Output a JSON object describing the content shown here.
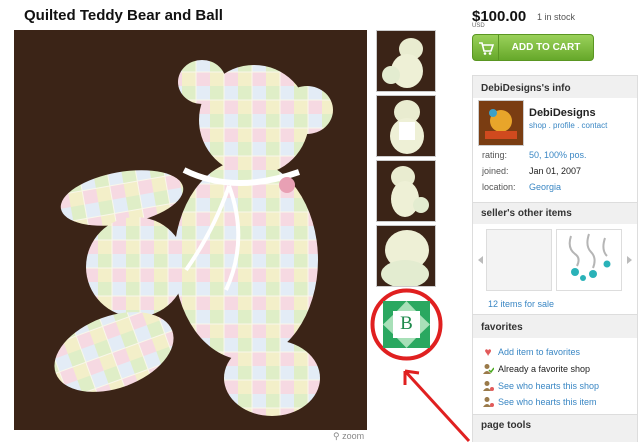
{
  "listing": {
    "title": "Quilted Teddy Bear and Ball",
    "price": "$100.00",
    "currency": "USD",
    "stock": "1 in stock",
    "add_to_cart": "ADD TO CART",
    "zoom": "zoom"
  },
  "shop_info": {
    "heading": "DebiDesigns's info",
    "name": "DebiDesigns",
    "links": [
      "shop",
      "profile",
      "contact"
    ],
    "rating_label": "rating:",
    "rating_value": "50, 100% pos.",
    "joined_label": "joined:",
    "joined_value": "Jan 01, 2007",
    "location_label": "location:",
    "location_value": "Georgia"
  },
  "other_items": {
    "heading": "seller's other items",
    "count_link": "12 items for sale"
  },
  "favorites": {
    "heading": "favorites",
    "add_item": "Add item to favorites",
    "already_fav": "Already a favorite shop",
    "hearts_shop": "See who hearts this shop",
    "hearts_item": "See who hearts this item"
  },
  "page_tools": {
    "heading": "page tools"
  },
  "badge": {
    "letter": "B"
  },
  "colors": {
    "link": "#3a87c4",
    "cart_green": "#7dbd3f",
    "annotation_red": "#e02020",
    "quilt_green": "#2aa860"
  }
}
